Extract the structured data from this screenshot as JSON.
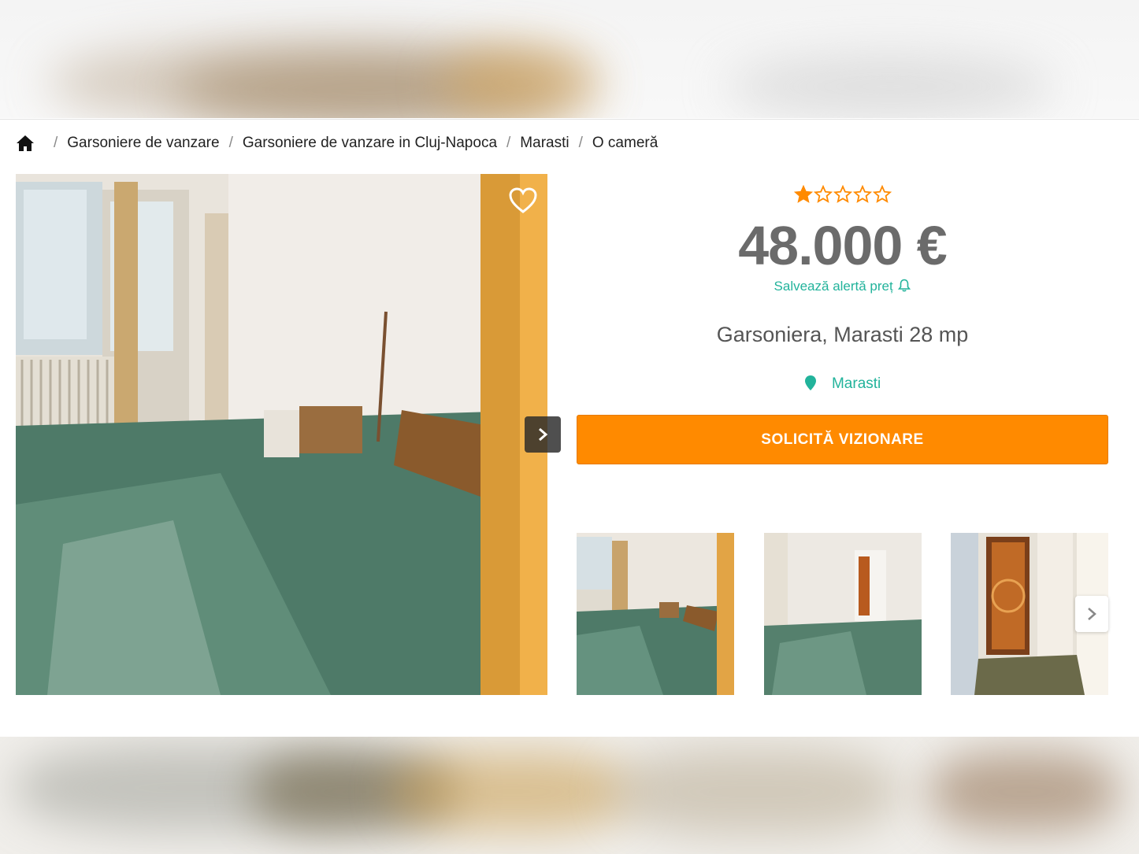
{
  "breadcrumb": {
    "home_icon": "home-icon",
    "items": [
      "Garsoniere de vanzare",
      "Garsoniere de vanzare in Cluj-Napoca",
      "Marasti",
      "O cameră"
    ],
    "separator": "/"
  },
  "listing": {
    "rating": 1,
    "rating_max": 5,
    "price": "48.000 €",
    "price_alert": "Salvează alertă preț",
    "title": "Garsoniera, Marasti 28 mp",
    "location": "Marasti",
    "cta": "SOLICITĂ VIZIONARE"
  },
  "colors": {
    "accent": "#ff8a00",
    "teal": "#22b39b",
    "price": "#6b6b6b"
  },
  "icons": {
    "favorite": "heart-icon",
    "next": "chevron-right-icon",
    "location": "map-pin-icon",
    "alert": "bell-icon",
    "star": "star-icon"
  }
}
